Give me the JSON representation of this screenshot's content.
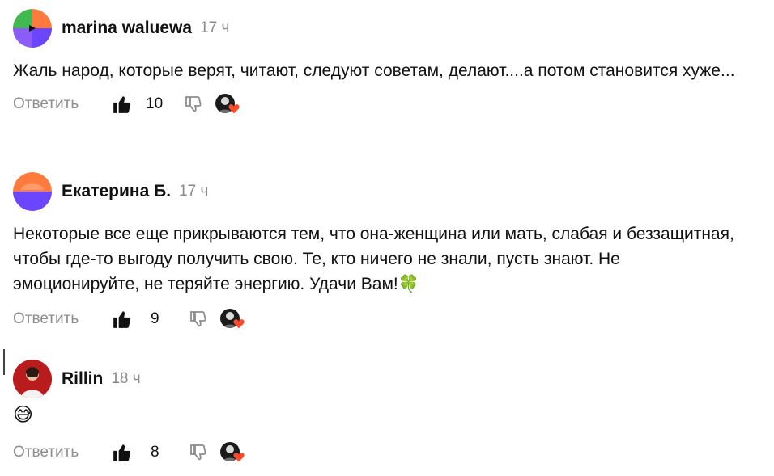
{
  "comments": [
    {
      "author": "marina waluewa",
      "time": "17 ч",
      "text": "Жаль народ, которые верят, читают, следуют советам, делают....а потом становится хуже...",
      "reply_label": "Ответить",
      "likes": "10",
      "avatar": "colorful-geometric-avatar"
    },
    {
      "author": "Екатерина Б.",
      "time": "17 ч",
      "text": "Некоторые все еще прикрываются тем, что она-женщина или мать, слабая и беззащитная, чтобы где-то выгоду получить свою. Те, кто ничего не знали, пусть знают. Не эмоционируйте, не теряйте энергию. Удачи Вам!🍀",
      "reply_label": "Ответить",
      "likes": "9",
      "avatar": "colorful-geometric-avatar"
    },
    {
      "author": "Rillin",
      "time": "18 ч",
      "text": "😅",
      "reply_label": "Ответить",
      "likes": "8",
      "avatar": "photo-avatar"
    }
  ],
  "colors": {
    "muted": "#8c8c8c",
    "heart": "#ff4b2b",
    "avatar_orange": "#ff7a3d",
    "avatar_purple": "#6b46ff",
    "avatar_green": "#3fb950"
  }
}
